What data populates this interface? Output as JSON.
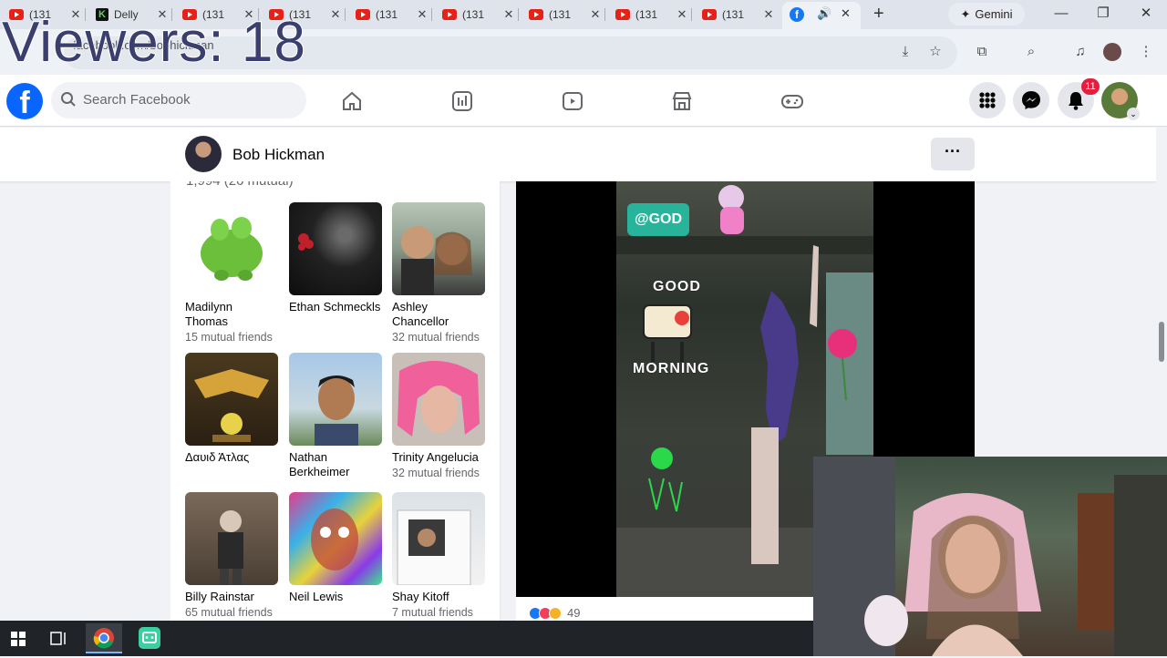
{
  "browser": {
    "tabs": [
      {
        "label": "(131",
        "favicon": "youtube-icon"
      },
      {
        "label": "Delly",
        "favicon": "k-logo-icon"
      },
      {
        "label": "(131",
        "favicon": "youtube-icon"
      },
      {
        "label": "(131",
        "favicon": "youtube-icon"
      },
      {
        "label": "(131",
        "favicon": "youtube-icon"
      },
      {
        "label": "(131",
        "favicon": "youtube-icon"
      },
      {
        "label": "(131",
        "favicon": "youtube-icon"
      },
      {
        "label": "(131",
        "favicon": "youtube-icon"
      },
      {
        "label": "(131",
        "favicon": "youtube-icon"
      }
    ],
    "active_tab_favicon": "facebook-icon",
    "close_glyph": "✕",
    "new_tab_glyph": "+",
    "gemini_label": "Gemini",
    "url": "facebook.com/bobhickman"
  },
  "overlay": {
    "viewers_text": "Viewers: 18"
  },
  "facebook": {
    "logo_letter": "f",
    "search_placeholder": "Search Facebook",
    "notification_count": "11",
    "accent": "#0866ff"
  },
  "profile": {
    "name": "Bob Hickman",
    "more_glyph": "···"
  },
  "friends": {
    "count_partial": "1,994 (26 mutual)",
    "items": [
      {
        "name": "Madilynn Thomas",
        "mutual": "15 mutual friends"
      },
      {
        "name": "Ethan Schmeckls",
        "mutual": ""
      },
      {
        "name": "Ashley Chancellor",
        "mutual": "32 mutual friends"
      },
      {
        "name": "Δαυιδ Άτλας",
        "mutual": ""
      },
      {
        "name": "Nathan Berkheimer",
        "mutual": ""
      },
      {
        "name": "Trinity Angelucia",
        "mutual": "32 mutual friends"
      },
      {
        "name": "Billy Rainstar",
        "mutual": "65 mutual friends"
      },
      {
        "name": "Neil Lewis",
        "mutual": ""
      },
      {
        "name": "Shay Kitoff",
        "mutual": "7 mutual friends"
      }
    ]
  },
  "post": {
    "video_tag": "@GOD",
    "sticker_top": "GOOD",
    "sticker_bottom": "MORNING",
    "reaction_count": "49"
  }
}
